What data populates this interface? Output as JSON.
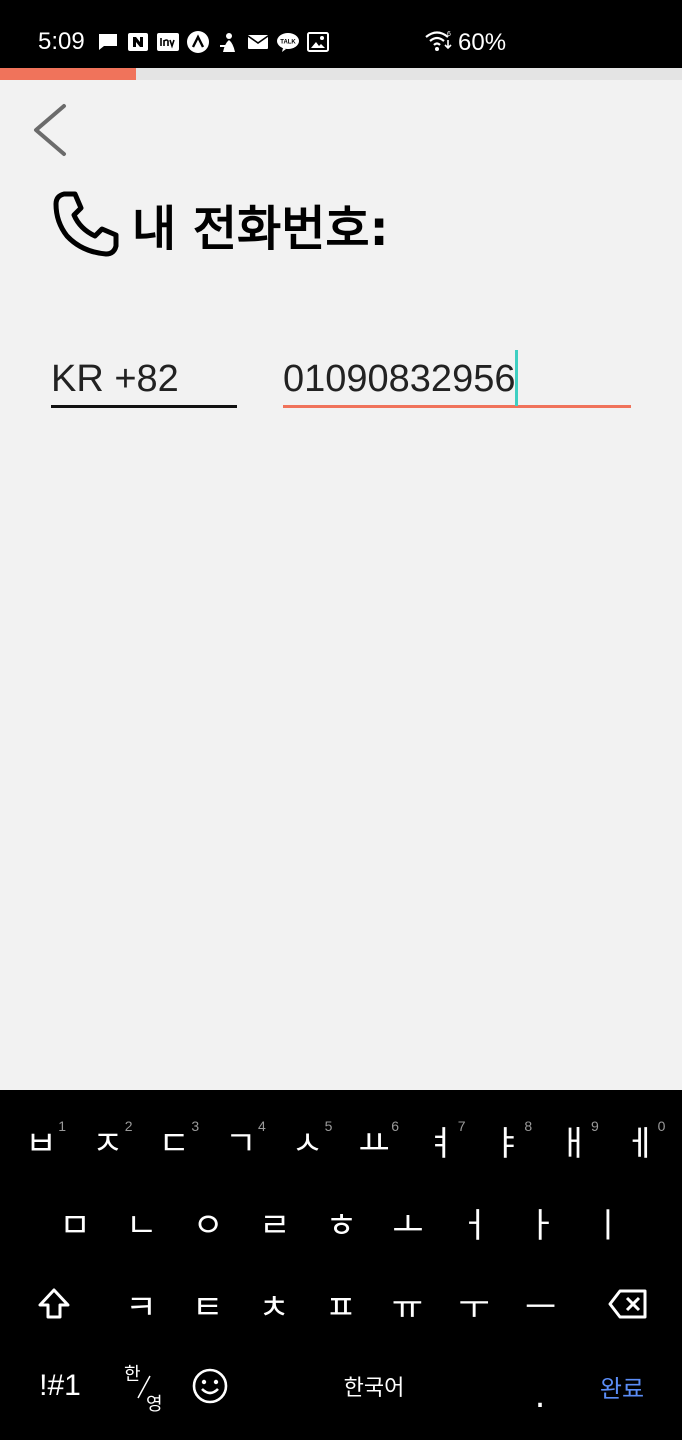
{
  "status_bar": {
    "time": "5:09",
    "notification_icons": [
      "message-icon",
      "naver-icon",
      "inven-icon",
      "navigation-icon",
      "app-icon",
      "mail-icon",
      "kakaotalk-icon",
      "image-icon"
    ],
    "battery": "60%"
  },
  "progress": {
    "value": 0.2,
    "color": "#f0735b"
  },
  "header": {
    "title": "내 전화번호:"
  },
  "form": {
    "country_code": "KR +82",
    "phone_number": "01090832956"
  },
  "keyboard": {
    "row1": [
      {
        "char": "ㅂ",
        "num": "1"
      },
      {
        "char": "ㅈ",
        "num": "2"
      },
      {
        "char": "ㄷ",
        "num": "3"
      },
      {
        "char": "ㄱ",
        "num": "4"
      },
      {
        "char": "ㅅ",
        "num": "5"
      },
      {
        "char": "ㅛ",
        "num": "6"
      },
      {
        "char": "ㅕ",
        "num": "7"
      },
      {
        "char": "ㅑ",
        "num": "8"
      },
      {
        "char": "ㅐ",
        "num": "9"
      },
      {
        "char": "ㅔ",
        "num": "0"
      }
    ],
    "row2": [
      "ㅁ",
      "ㄴ",
      "ㅇ",
      "ㄹ",
      "ㅎ",
      "ㅗ",
      "ㅓ",
      "ㅏ",
      "ㅣ"
    ],
    "row3": [
      "ㅋ",
      "ㅌ",
      "ㅊ",
      "ㅍ",
      "ㅠ",
      "ㅜ",
      "ㅡ"
    ],
    "symbols_label": "!#1",
    "lang_toggle_top": "한",
    "lang_toggle_bottom": "영",
    "space_label": "한국어",
    "period_label": ".",
    "done_label": "완료"
  }
}
